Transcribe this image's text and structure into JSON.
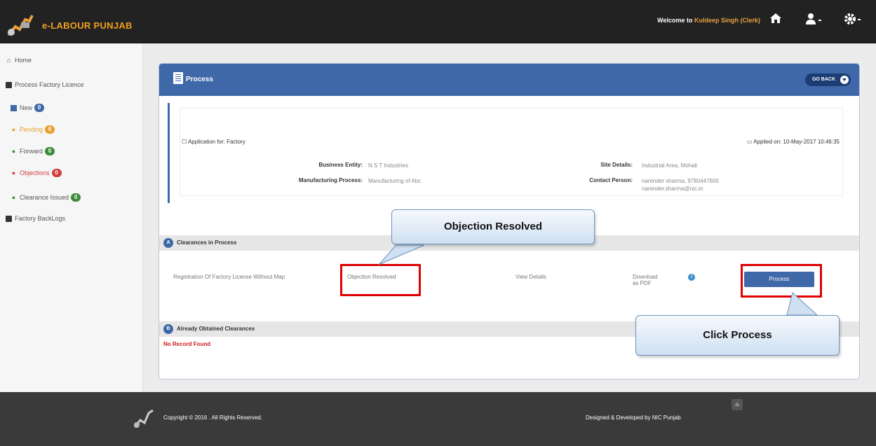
{
  "header": {
    "brand": "e-LABOUR PUNJAB",
    "welcome_prefix": "Welcome to",
    "welcome_user": "Kuldeep Singh (Clerk)",
    "home_icon": "home-icon",
    "user_icon": "user-icon",
    "settings_icon": "gear-icon"
  },
  "sidebar": {
    "home": "Home",
    "process_factory_licence": "Process Factory Licence",
    "items": [
      {
        "label": "New",
        "count": "0",
        "color": "#3f68a8"
      },
      {
        "label": "Pending",
        "count": "0",
        "color": "#e8a030"
      },
      {
        "label": "Forward",
        "count": "0",
        "color": "#3c8c3c"
      },
      {
        "label": "Objections",
        "count": "0",
        "color": "#d04040"
      },
      {
        "label": "Clearance Issued",
        "count": "0",
        "color": "#3c8c3c"
      }
    ],
    "factory_backlogs": "Factory BackLogs"
  },
  "panel": {
    "title": "Process",
    "goback": "GO BACK",
    "application_for": "Application for: Factory",
    "applied_on": "Applied on: 10-May-2017 10:46:35",
    "business_entity_label": "Business Entity:",
    "business_entity_value": "N S T Industries",
    "manufacturing_label": "Manufacturing Process:",
    "manufacturing_value": "Manufacturing of Abc",
    "site_label": "Site Details:",
    "site_value": "Industrial Area, Mohali",
    "contact_label": "Contact Person:",
    "contact_line1": "narender sharma, 9780447600",
    "contact_line2": "narender.sharma@nic.in"
  },
  "clearances": {
    "section_a_letter": "A",
    "section_a_title": "Clearances in Process",
    "row_name": "Registration Of Factory License Without Map",
    "row_status": "Objection Resolved",
    "row_view": "View Details",
    "row_download": "Download",
    "row_download2": "as PDF",
    "row_info": "i",
    "row_button": "Process",
    "section_b_letter": "B",
    "section_b_title": "Already Obtained Clearances",
    "no_record": "No Record Found"
  },
  "callouts": {
    "objection": "Objection Resolved",
    "click_process": "Click Process"
  },
  "footer": {
    "copyright": "Copyright © 2016 . All Rights Reserved.",
    "designed": "Designed & Developed by NIC Punjab"
  },
  "colors": {
    "header_bg": "#222222",
    "panel_header": "#3f68a8",
    "highlight": "#e00000",
    "brand": "#f0a020"
  }
}
